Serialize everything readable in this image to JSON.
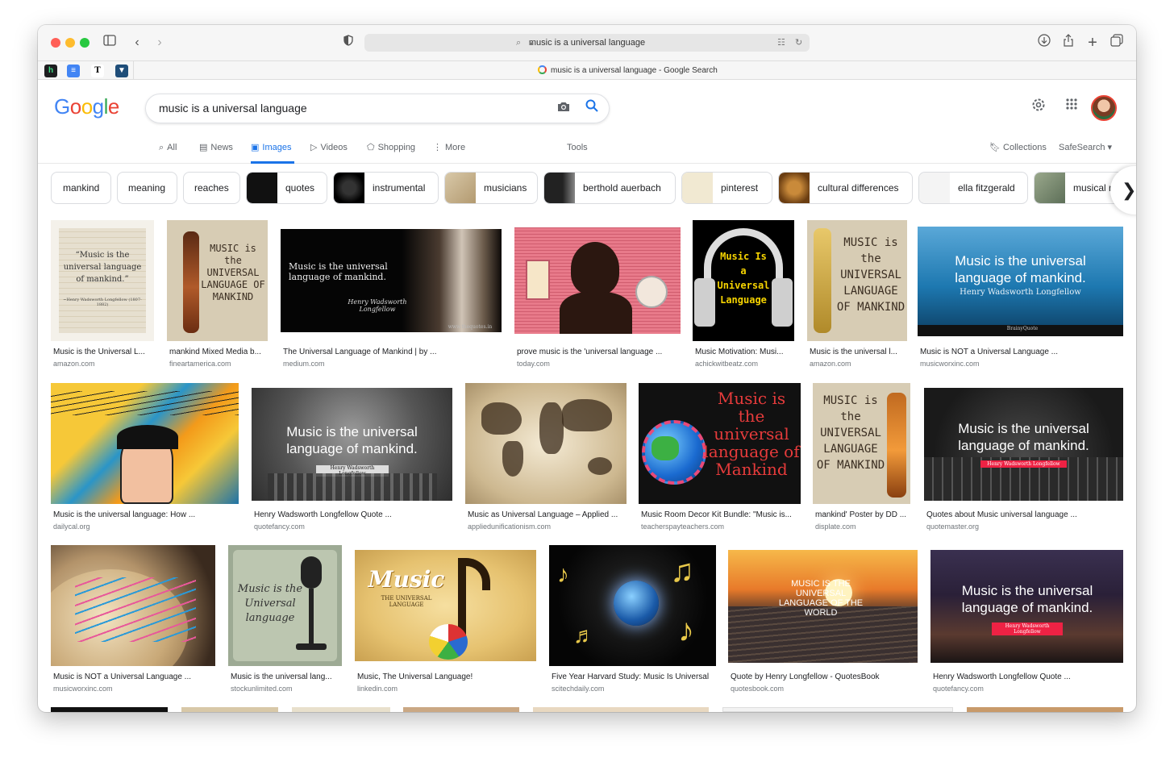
{
  "browser": {
    "address": "music is a universal language",
    "tab_title": "music is a universal language - Google Search",
    "favorites": [
      {
        "name": "h",
        "color": "#1d1d1f"
      },
      {
        "name": "docs",
        "color": "#4285f4"
      },
      {
        "name": "T",
        "color": "#ffffff"
      },
      {
        "name": "shield",
        "color": "#1f4e79"
      }
    ]
  },
  "google": {
    "logo": "Google",
    "query": "music is a universal language",
    "tabs": [
      "All",
      "News",
      "Images",
      "Videos",
      "Shopping",
      "More",
      "Tools"
    ],
    "active_tab": "Images",
    "collections": "Collections",
    "safesearch": "SafeSearch ▾"
  },
  "chips": [
    "mankind",
    "meaning",
    "reaches",
    "quotes",
    "instrumental",
    "musicians",
    "berthold auerbach",
    "pinterest",
    "cultural differences",
    "ella fitzgerald",
    "musical r"
  ],
  "results": [
    {
      "title": "Music is the Universal L...",
      "source": "amazon.com",
      "overlay": "“Music is the universal language of mankind.”",
      "sub": "~Henry Wadsworth Longfellow (1807-1882)"
    },
    {
      "title": "mankind Mixed Media b...",
      "source": "fineartamerica.com",
      "overlay": "MUSIC is the UNIVERSAL LANGUAGE OF MANKIND"
    },
    {
      "title": "The Universal Language of Mankind | by ...",
      "source": "medium.com",
      "overlay": "Music is the universal language of mankind.",
      "sub": "Henry Wadsworth Longfellow",
      "foot": "www.thequotes.in"
    },
    {
      "title": "prove music is the 'universal language ...",
      "source": "today.com"
    },
    {
      "title": "Music Motivation: Musi...",
      "source": "achickwitbeatz.com",
      "overlay": "Music Is a Universal Language"
    },
    {
      "title": "Music is the universal l...",
      "source": "amazon.com",
      "overlay": "MUSIC is the UNIVERSAL LANGUAGE OF MANKIND"
    },
    {
      "title": "Music is NOT a Universal Language ...",
      "source": "musicworxinc.com",
      "overlay": "Music is the universal language of mankind.",
      "sub": "Henry Wadsworth Longfellow",
      "foot": "BrainyQuote"
    },
    {
      "title": "Music is the universal language: How ...",
      "source": "dailycal.org"
    },
    {
      "title": "Henry Wadsworth Longfellow Quote ...",
      "source": "quotefancy.com",
      "overlay": "Music is the universal language of mankind.",
      "sub": "Henry Wadsworth Longfellow"
    },
    {
      "title": "Music as Universal Language – Applied ...",
      "source": "appliedunificationism.com"
    },
    {
      "title": "Music Room Decor Kit Bundle: \"Music is...",
      "source": "teacherspayteachers.com",
      "overlay": "Music is the universal language of Mankind"
    },
    {
      "title": "mankind' Poster by DD ...",
      "source": "displate.com",
      "overlay": "MUSIC is the UNIVERSAL LANGUAGE OF MANKIND"
    },
    {
      "title": "Quotes about Music universal language ...",
      "source": "quotemaster.org",
      "overlay": "Music is the universal language of mankind.",
      "sub": "Henry Wadsworth Longfellow"
    },
    {
      "title": "Music is NOT a Universal Language ...",
      "source": "musicworxinc.com"
    },
    {
      "title": "Music is the universal lang...",
      "source": "stockunlimited.com",
      "overlay": "Music is the Universal language"
    },
    {
      "title": "Music, The Universal Language!",
      "source": "linkedin.com",
      "overlay": "Music",
      "sub": "THE UNIVERSAL LANGUAGE"
    },
    {
      "title": "Five Year Harvard Study: Music Is Universal",
      "source": "scitechdaily.com"
    },
    {
      "title": "Quote by Henry Longfellow - QuotesBook",
      "source": "quotesbook.com",
      "overlay": "MUSIC IS THE UNIVERSAL LANGUAGE OF THE WORLD"
    },
    {
      "title": "Henry Wadsworth Longfellow Quote ...",
      "source": "quotefancy.com",
      "overlay": "Music is the universal language of mankind.",
      "sub": "Henry Wadsworth Longfellow"
    }
  ]
}
